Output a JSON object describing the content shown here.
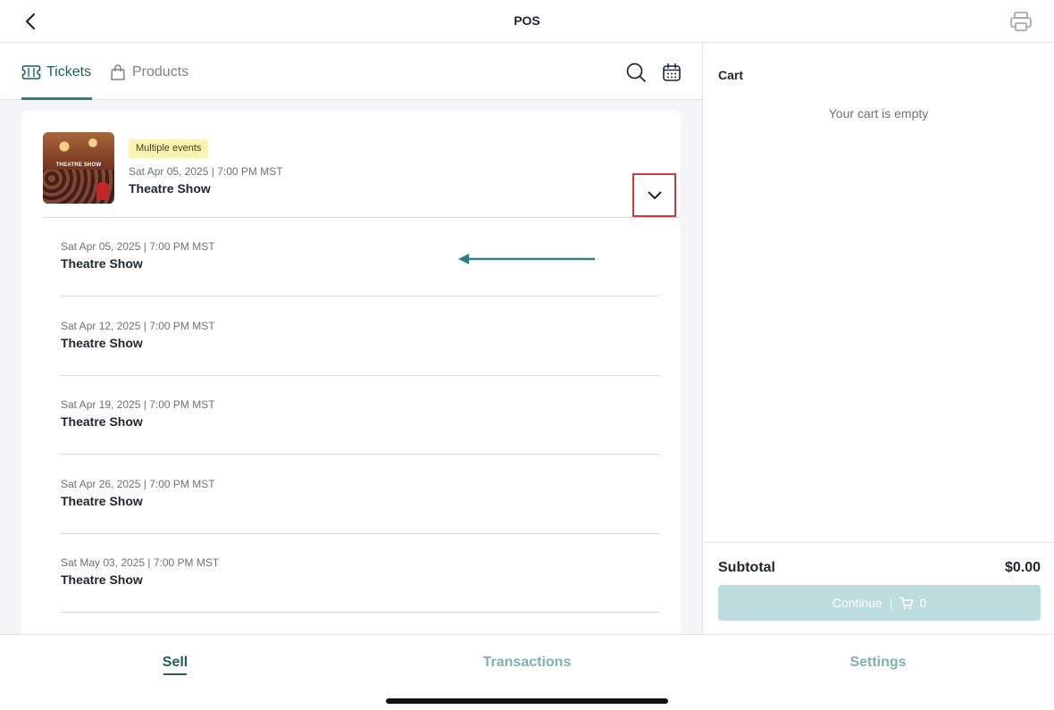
{
  "topbar": {
    "title": "POS",
    "back_icon": "chevron-left-icon",
    "print_icon": "printer-icon"
  },
  "tabs": [
    {
      "label": "Tickets",
      "icon": "ticket-icon",
      "active": true
    },
    {
      "label": "Products",
      "icon": "shopping-bag-icon",
      "active": false
    }
  ],
  "tools": {
    "search_icon": "search-icon",
    "calendar_icon": "calendar-icon"
  },
  "event": {
    "badge": "Multiple events",
    "datetime": "Sat Apr 05, 2025  |  7:00 PM MST",
    "name": "Theatre Show",
    "thumbnail_caption": "THEATRE SHOW",
    "expand_icon": "chevron-down-icon"
  },
  "occurrences": [
    {
      "datetime": "Sat Apr 05, 2025  |  7:00 PM MST",
      "name": "Theatre Show"
    },
    {
      "datetime": "Sat Apr 12, 2025  |  7:00 PM MST",
      "name": "Theatre Show"
    },
    {
      "datetime": "Sat Apr 19, 2025  |  7:00 PM MST",
      "name": "Theatre Show"
    },
    {
      "datetime": "Sat Apr 26, 2025  |  7:00 PM MST",
      "name": "Theatre Show"
    },
    {
      "datetime": "Sat May 03, 2025  |  7:00 PM MST",
      "name": "Theatre Show"
    }
  ],
  "cart": {
    "title": "Cart",
    "empty_message": "Your cart is empty",
    "subtotal_label": "Subtotal",
    "subtotal_value": "$0.00",
    "continue_label": "Continue",
    "separator": "|",
    "count": "0"
  },
  "bottom_nav": {
    "sell": "Sell",
    "transactions": "Transactions",
    "settings": "Settings"
  },
  "colors": {
    "accent": "#1f5f63",
    "accent_light": "#7fb1b4",
    "highlight_box": "#d13a3a",
    "annotation_arrow": "#2f7f84",
    "continue_disabled": "#bcdcdd"
  }
}
